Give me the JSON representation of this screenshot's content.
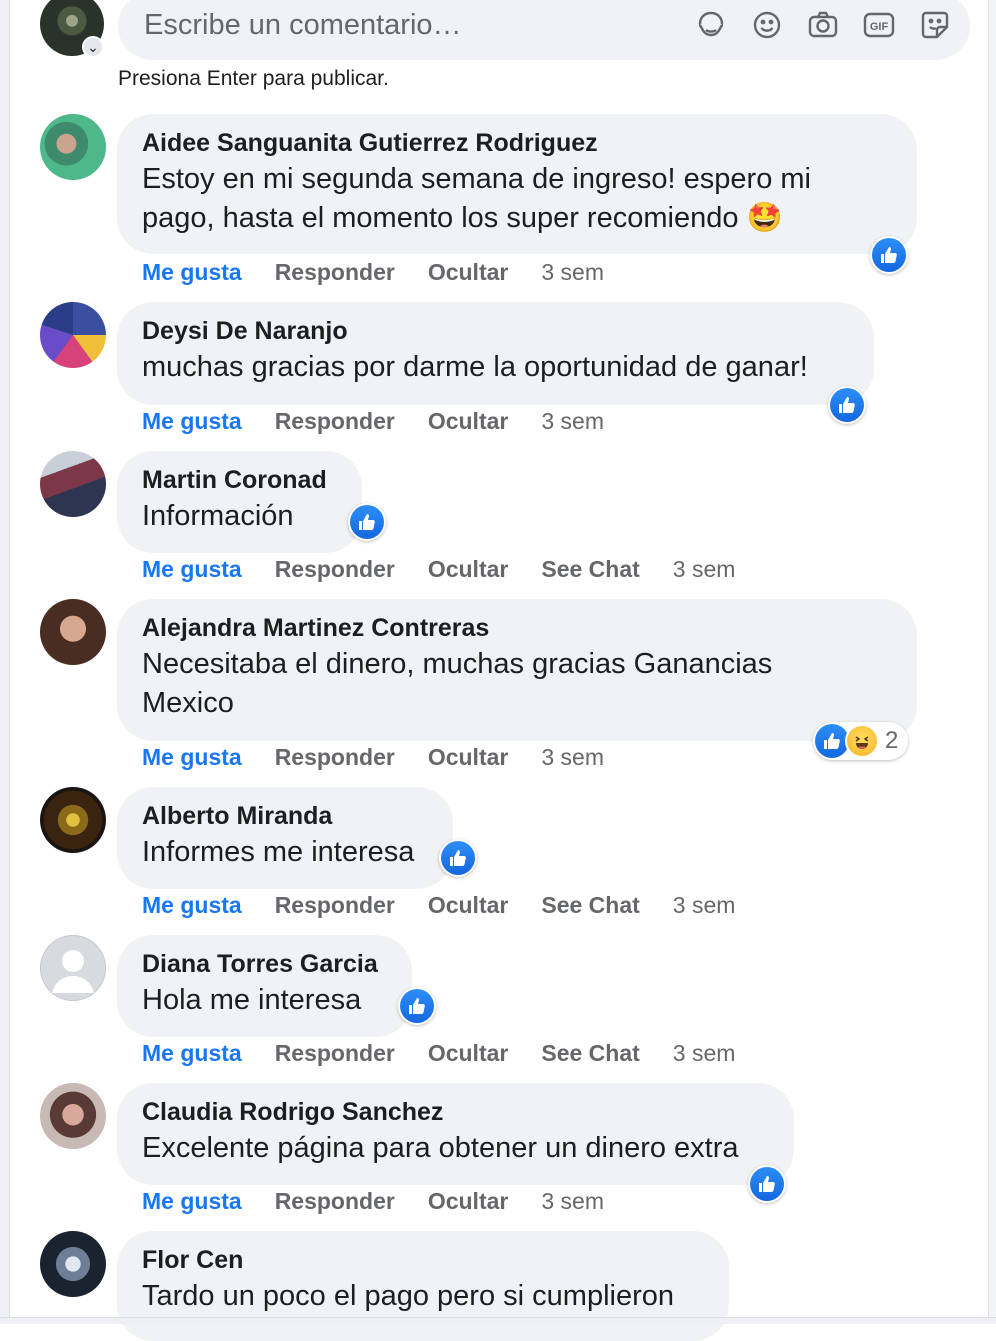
{
  "composer": {
    "placeholder": "Escribe un comentario…",
    "hint": "Presiona Enter para publicar.",
    "icons": [
      "sticker-face-icon",
      "emoji-icon",
      "camera-icon",
      "gif-icon",
      "sticker-icon"
    ],
    "gif_label": "GIF"
  },
  "colors": {
    "link": "#1877f2",
    "muted": "#65676b",
    "bubble": "#f0f2f5"
  },
  "comments": [
    {
      "author": "Aidee Sanguanita Gutierrez Rodriguez",
      "text_lines": [
        "Estoy en mi segunda semana de ingreso! espero mi",
        "pago, hasta el momento los super recomiendo 🤩"
      ],
      "actions": [
        "Me gusta",
        "Responder",
        "Ocultar"
      ],
      "time": "3 sem",
      "reactions": [
        "like"
      ]
    },
    {
      "author": "Deysi De Naranjo",
      "text_lines": [
        "muchas gracias por darme la oportunidad de ganar!"
      ],
      "actions": [
        "Me gusta",
        "Responder",
        "Ocultar"
      ],
      "time": "3 sem",
      "reactions": [
        "like"
      ]
    },
    {
      "author": "Martin Coronad",
      "text_lines": [
        "Información"
      ],
      "actions": [
        "Me gusta",
        "Responder",
        "Ocultar",
        "See Chat"
      ],
      "time": "3 sem",
      "reactions": [
        "like"
      ]
    },
    {
      "author": "Alejandra Martinez Contreras",
      "text_lines": [
        "Necesitaba el dinero, muchas gracias Ganancias",
        "Mexico"
      ],
      "actions": [
        "Me gusta",
        "Responder",
        "Ocultar"
      ],
      "time": "3 sem",
      "reactions": [
        "like",
        "haha"
      ],
      "reaction_count": "2"
    },
    {
      "author": "Alberto Miranda",
      "text_lines": [
        "Informes me interesa"
      ],
      "actions": [
        "Me gusta",
        "Responder",
        "Ocultar",
        "See Chat"
      ],
      "time": "3 sem",
      "reactions": [
        "like"
      ]
    },
    {
      "author": "Diana Torres Garcia",
      "text_lines": [
        "Hola me interesa"
      ],
      "actions": [
        "Me gusta",
        "Responder",
        "Ocultar",
        "See Chat"
      ],
      "time": "3 sem",
      "reactions": [
        "like"
      ]
    },
    {
      "author": "Claudia Rodrigo Sanchez",
      "text_lines": [
        "Excelente página para obtener un dinero extra"
      ],
      "actions": [
        "Me gusta",
        "Responder",
        "Ocultar"
      ],
      "time": "3 sem",
      "reactions": [
        "like"
      ]
    },
    {
      "author": "Flor Cen",
      "text_lines": [
        "Tardo un poco el pago pero si cumplieron"
      ],
      "actions": [],
      "time": "",
      "reactions": []
    }
  ]
}
